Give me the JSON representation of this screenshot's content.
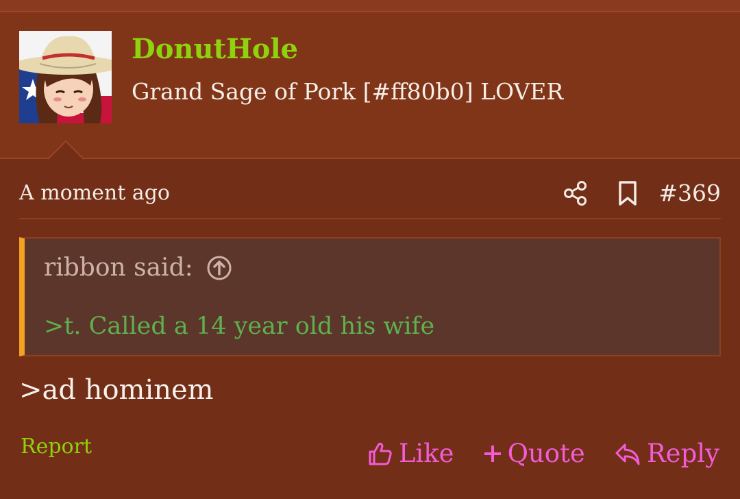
{
  "author": {
    "name": "DonutHole",
    "title": "Grand Sage of Pork [#ff80b0] LOVER",
    "avatar_icon": "cowgirl-avatar"
  },
  "meta": {
    "time": "A moment ago",
    "post_number": "#369",
    "share_icon": "share-icon",
    "bookmark_icon": "bookmark-icon"
  },
  "quote": {
    "author_line": "ribbon said:",
    "text": ">t. Called a 14 year old his wife"
  },
  "body": ">ad hominem",
  "actions": {
    "report": "Report",
    "like": "Like",
    "quote": "Quote",
    "reply": "Reply"
  },
  "colors": {
    "background": "#722e16",
    "header": "#803519",
    "username": "#8fd20e",
    "greentext": "#5fb04f",
    "action": "#f45bd8",
    "quote_bar": "#f5a223"
  }
}
